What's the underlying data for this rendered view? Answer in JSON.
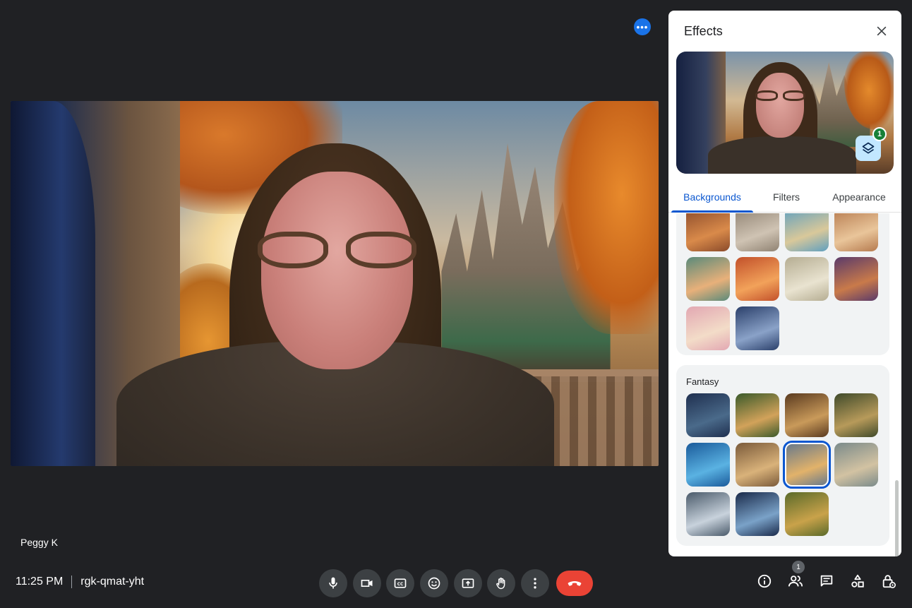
{
  "call": {
    "participant_name": "Peggy K",
    "time": "11:25 PM",
    "meeting_code": "rgk-qmat-yht",
    "people_count": "1"
  },
  "panel": {
    "title": "Effects",
    "applied_count": "1",
    "tabs": [
      {
        "label": "Backgrounds",
        "active": true
      },
      {
        "label": "Filters",
        "active": false
      },
      {
        "label": "Appearance",
        "active": false
      }
    ]
  },
  "sections": {
    "upper": {
      "label": "",
      "thumbs": [
        {
          "name": "cozy-room",
          "colors": [
            "#8a4a2a",
            "#d98a4a"
          ]
        },
        {
          "name": "living-room",
          "colors": [
            "#8f8272",
            "#cfc3b3"
          ]
        },
        {
          "name": "beach-window",
          "colors": [
            "#5f9fbf",
            "#d9c89a"
          ]
        },
        {
          "name": "paris-window",
          "colors": [
            "#b57a4e",
            "#e9c59a"
          ]
        },
        {
          "name": "diner",
          "colors": [
            "#5a8a7a",
            "#e8b07a"
          ]
        },
        {
          "name": "retro-kitchen",
          "colors": [
            "#c2502a",
            "#f2a25a"
          ]
        },
        {
          "name": "minimal-room",
          "colors": [
            "#b5ad92",
            "#e9e3d0"
          ]
        },
        {
          "name": "night-cafe",
          "colors": [
            "#5a3a6a",
            "#c97a4a"
          ]
        },
        {
          "name": "pink-sky",
          "colors": [
            "#e2a7b2",
            "#f3dcc8"
          ]
        },
        {
          "name": "car-interior",
          "colors": [
            "#2a3f6a",
            "#8aa2c8"
          ]
        }
      ]
    },
    "fantasy": {
      "label": "Fantasy",
      "thumbs": [
        {
          "name": "dark-hall",
          "colors": [
            "#1f2f4f",
            "#4a6a8a"
          ],
          "selected": false
        },
        {
          "name": "forest-camp",
          "colors": [
            "#3a5a2a",
            "#d2a25a"
          ],
          "selected": false
        },
        {
          "name": "golden-chamber",
          "colors": [
            "#5a3a1f",
            "#c99a5a"
          ],
          "selected": false
        },
        {
          "name": "forest-ruins",
          "colors": [
            "#3f4a2a",
            "#b79a5a"
          ],
          "selected": false
        },
        {
          "name": "underwater",
          "colors": [
            "#1a5a9a",
            "#5ab2e2"
          ],
          "selected": false
        },
        {
          "name": "desert-town",
          "colors": [
            "#7a5a3a",
            "#d9b27a"
          ],
          "selected": false
        },
        {
          "name": "castle-balcony",
          "colors": [
            "#6a7a8a",
            "#e2b26a"
          ],
          "selected": true
        },
        {
          "name": "futuristic-city",
          "colors": [
            "#7a8a8a",
            "#d2c2a2"
          ],
          "selected": false
        },
        {
          "name": "space-station",
          "colors": [
            "#4a5a6a",
            "#c8d2dc"
          ],
          "selected": false
        },
        {
          "name": "cockpit",
          "colors": [
            "#1a2a4a",
            "#7aa2c8"
          ],
          "selected": false
        },
        {
          "name": "hobbit-home",
          "colors": [
            "#5a6a2a",
            "#c9a24a"
          ],
          "selected": false
        }
      ]
    }
  },
  "colors": {
    "accent": "#0b57d0",
    "hangup": "#ea4335",
    "background": "#202124",
    "control_bg": "#3c4043"
  },
  "icons": [
    "more-icon",
    "close-icon",
    "layers-icon",
    "mic-icon",
    "camera-icon",
    "captions-icon",
    "emoji-icon",
    "present-icon",
    "raise-hand-icon",
    "more-vert-icon",
    "hangup-icon",
    "info-icon",
    "people-icon",
    "chat-icon",
    "activities-icon",
    "host-controls-icon"
  ]
}
